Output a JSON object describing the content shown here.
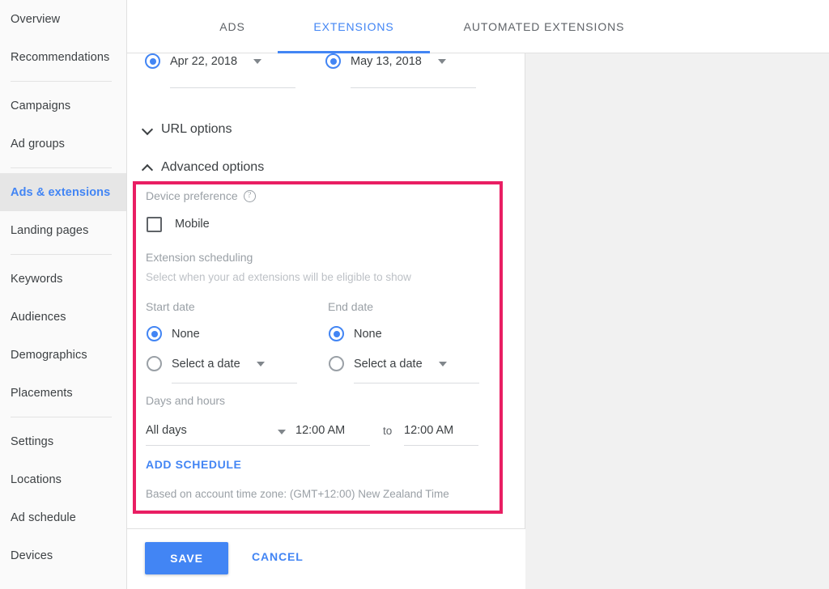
{
  "sidebar": {
    "groups": [
      {
        "items": [
          {
            "label": "Overview",
            "active": false
          },
          {
            "label": "Recommendations",
            "active": false
          }
        ]
      },
      {
        "items": [
          {
            "label": "Campaigns",
            "active": false
          },
          {
            "label": "Ad groups",
            "active": false
          }
        ]
      },
      {
        "items": [
          {
            "label": "Ads & extensions",
            "active": true
          },
          {
            "label": "Landing pages",
            "active": false
          }
        ]
      },
      {
        "items": [
          {
            "label": "Keywords",
            "active": false
          },
          {
            "label": "Audiences",
            "active": false
          },
          {
            "label": "Demographics",
            "active": false
          },
          {
            "label": "Placements",
            "active": false
          }
        ]
      },
      {
        "items": [
          {
            "label": "Settings",
            "active": false
          },
          {
            "label": "Locations",
            "active": false
          },
          {
            "label": "Ad schedule",
            "active": false
          },
          {
            "label": "Devices",
            "active": false
          }
        ]
      }
    ]
  },
  "tabs": [
    {
      "label": "ADS",
      "active": false
    },
    {
      "label": "EXTENSIONS",
      "active": true
    },
    {
      "label": "AUTOMATED EXTENSIONS",
      "active": false
    }
  ],
  "date_row": {
    "start": {
      "value": "Apr 22, 2018",
      "selected": true
    },
    "end": {
      "value": "May 13, 2018",
      "selected": true
    }
  },
  "sections": {
    "url_options": {
      "label": "URL options",
      "expanded": false
    },
    "advanced_options": {
      "label": "Advanced options",
      "expanded": true
    }
  },
  "advanced": {
    "device_preference": {
      "label": "Device preference",
      "help_glyph": "?",
      "mobile_label": "Mobile",
      "mobile_checked": false
    },
    "extension_scheduling": {
      "label": "Extension scheduling",
      "description": "Select when your ad extensions will be eligible to show",
      "start_date": {
        "heading": "Start date",
        "none_label": "None",
        "none_selected": true,
        "select_label": "Select a date",
        "select_selected": false
      },
      "end_date": {
        "heading": "End date",
        "none_label": "None",
        "none_selected": true,
        "select_label": "Select a date",
        "select_selected": false
      },
      "days_and_hours": {
        "heading": "Days and hours",
        "days_value": "All days",
        "time_from": "12:00 AM",
        "separator": "to",
        "time_to": "12:00 AM"
      },
      "add_schedule_label": "ADD SCHEDULE",
      "timezone_note": "Based on account time zone: (GMT+12:00) New Zealand Time"
    }
  },
  "footer": {
    "save_label": "SAVE",
    "cancel_label": "CANCEL"
  },
  "colors": {
    "accent_blue": "#4285f4",
    "highlight_pink": "#e91e63",
    "muted_gray": "#9aa0a6"
  }
}
